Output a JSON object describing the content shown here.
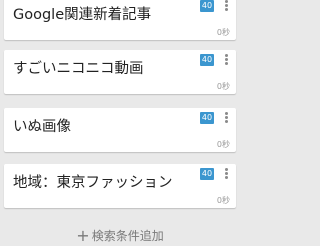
{
  "cards": [
    {
      "title": "Google関連新着記事",
      "count": "40",
      "time": "0秒"
    },
    {
      "title": "すごいニコニコ動画",
      "count": "40",
      "time": "0秒"
    },
    {
      "title": "いぬ画像",
      "count": "40",
      "time": "0秒"
    },
    {
      "title": "地域：東京ファッション",
      "count": "40",
      "time": "0秒"
    }
  ],
  "add_condition_label": "検索条件追加",
  "colors": {
    "background": "#e9e9e9",
    "card": "#ffffff",
    "badge": "#3b96cf",
    "text": "#222222",
    "muted": "#9a9a9a"
  },
  "icons": {
    "menu": "kebab-menu-icon",
    "add": "plus-icon"
  }
}
